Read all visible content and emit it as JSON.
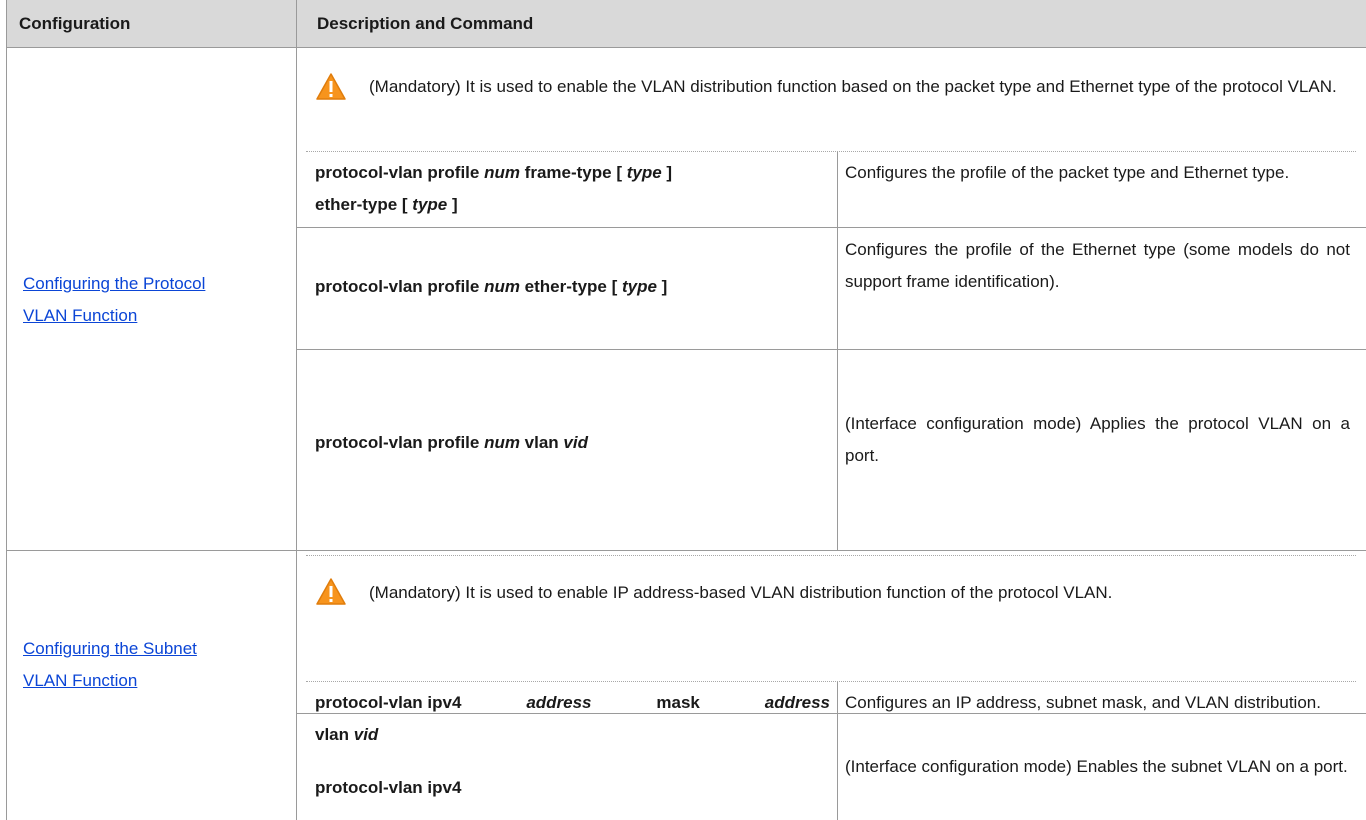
{
  "header": {
    "configuration": "Configuration",
    "description_and_command": "Description and Command"
  },
  "sections": [
    {
      "link_line1": "Configuring the Protocol",
      "link_line2": "VLAN Function",
      "warning_icon": "warning-triangle-icon",
      "note": "(Mandatory) It is used to enable the VLAN distribution function based on the packet type and Ethernet type of the protocol VLAN.",
      "rows": [
        {
          "cmd": {
            "a": "protocol-vlan profile ",
            "b": "num",
            "c": " frame-type [ ",
            "d": "type",
            "e": " ]",
            "f": "ether-type [ ",
            "g": "type",
            "h": " ]"
          },
          "desc": "Configures the profile of the packet type and Ethernet type."
        },
        {
          "cmd": {
            "a": "protocol-vlan profile ",
            "b": "num",
            "c": " ether-type [ ",
            "d": "type",
            "e": " ]"
          },
          "desc": "Configures the profile of the Ethernet type (some models do not support frame identification)."
        },
        {
          "cmd": {
            "a": "protocol-vlan profile ",
            "b": "num",
            "c": " vlan ",
            "d": "vid"
          },
          "desc": "(Interface configuration mode) Applies the protocol VLAN on a port."
        }
      ]
    },
    {
      "link_line1": "Configuring the Subnet",
      "link_line2": "VLAN Function",
      "warning_icon": "warning-triangle-icon",
      "note": "(Mandatory) It is used to enable IP address-based VLAN distribution function of the protocol VLAN.",
      "rows": [
        {
          "cmd": {
            "a": "protocol-vlan ipv4 ",
            "b": "address",
            "c": " mask ",
            "d": "address",
            "e": "vlan ",
            "f": "vid"
          },
          "desc": "Configures an IP address, subnet mask, and VLAN distribution."
        },
        {
          "cmd": {
            "a": "protocol-vlan ipv4"
          },
          "desc": "(Interface configuration mode) Enables the subnet VLAN on a port."
        }
      ]
    }
  ],
  "colors": {
    "header_bg": "#d9d9d9",
    "link": "#0b45d6",
    "warning_fill": "#f7941d",
    "grid": "#9a9a9a"
  }
}
